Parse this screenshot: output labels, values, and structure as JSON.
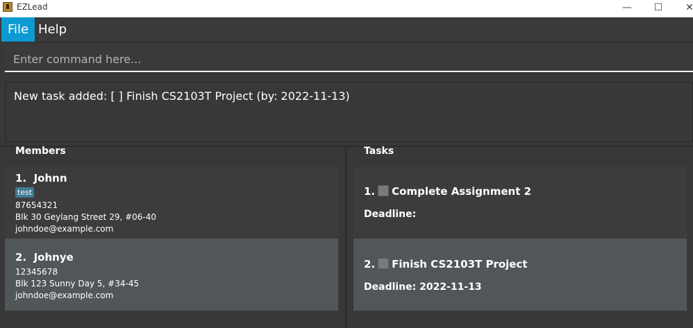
{
  "window": {
    "title": "EZLead",
    "min": "—",
    "max": "☐",
    "close": "✕"
  },
  "menu": {
    "file": "File",
    "help": "Help"
  },
  "command": {
    "placeholder": "Enter command here..."
  },
  "result": {
    "text": "New task added: [ ] Finish CS2103T Project (by: 2022-11-13)"
  },
  "members": {
    "title": "Members",
    "items": [
      {
        "index": "1.",
        "name": "Johnn",
        "tag": "test",
        "phone": "87654321",
        "address": "Blk 30 Geylang Street 29, #06-40",
        "email": "johndoe@example.com"
      },
      {
        "index": "2.",
        "name": "Johnye",
        "phone": "12345678",
        "address": "Blk 123 Sunny Day 5, #34-45",
        "email": "johndoe@example.com"
      }
    ]
  },
  "tasks": {
    "title": "Tasks",
    "items": [
      {
        "index": "1.",
        "name": "Complete Assignment 2",
        "deadline_label": "Deadline:",
        "deadline": ""
      },
      {
        "index": "2.",
        "name": "Finish CS2103T Project",
        "deadline_label": "Deadline:",
        "deadline": "2022-11-13"
      }
    ]
  }
}
